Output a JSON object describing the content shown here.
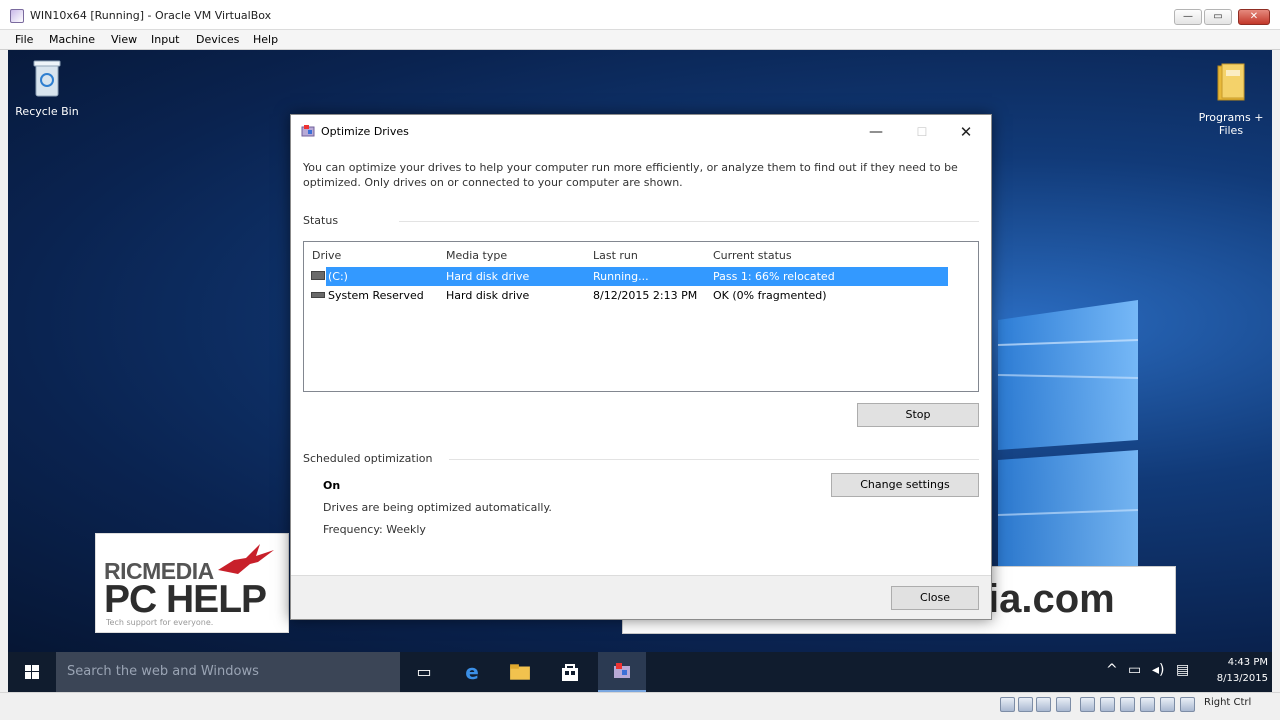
{
  "vbox": {
    "title": "WIN10x64 [Running] - Oracle VM VirtualBox",
    "menu": [
      "File",
      "Machine",
      "View",
      "Input",
      "Devices",
      "Help"
    ],
    "controls": {
      "minimize": "—",
      "restore": "▭",
      "close": "✕"
    },
    "host_key": "Right Ctrl"
  },
  "desktop": {
    "icons": [
      {
        "label": "Recycle Bin"
      },
      {
        "label": "Programs + Files"
      }
    ]
  },
  "dialog": {
    "title": "Optimize Drives",
    "controls": {
      "minimize": "—",
      "maximize": "☐",
      "close": "✕"
    },
    "intro": "You can optimize your drives to help your computer run more efficiently, or analyze them to find out if they need to be optimized. Only drives on or connected to your computer are shown.",
    "status_label": "Status",
    "columns": [
      "Drive",
      "Media type",
      "Last run",
      "Current status"
    ],
    "drives": [
      {
        "drive": "(C:)",
        "media_type": "Hard disk drive",
        "last_run": "Running...",
        "current_status": "Pass 1: 66% relocated",
        "selected": true
      },
      {
        "drive": "System Reserved",
        "media_type": "Hard disk drive",
        "last_run": "8/12/2015 2:13 PM",
        "current_status": "OK (0% fragmented)",
        "selected": false
      }
    ],
    "stop_button": "Stop",
    "scheduled_label": "Scheduled optimization",
    "schedule_state": "On",
    "schedule_desc": "Drives are being optimized automatically.",
    "frequency": "Frequency: Weekly",
    "change_settings_button": "Change settings",
    "close_button": "Close"
  },
  "watermark": {
    "brand_line1": "RICMEDIA",
    "brand_line2": "PC HELP",
    "tagline": "Tech support for everyone.",
    "url_visible": "ia.com"
  },
  "taskbar": {
    "search_placeholder": "Search the web and Windows",
    "time": "4:43 PM",
    "date": "8/13/2015"
  },
  "colors": {
    "selection": "#3399ff",
    "taskbar": "#101c2e",
    "desktop_blue": "#113a78"
  }
}
